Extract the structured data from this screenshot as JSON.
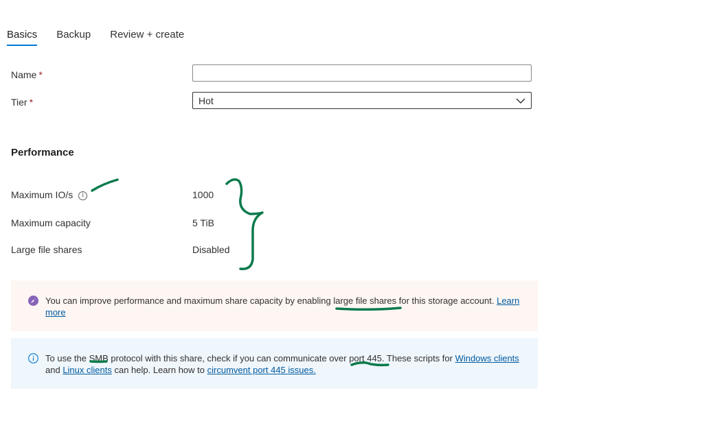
{
  "tabs": [
    {
      "label": "Basics",
      "active": true
    },
    {
      "label": "Backup",
      "active": false
    },
    {
      "label": "Review + create",
      "active": false
    }
  ],
  "form": {
    "name_label": "Name",
    "name_value": "",
    "tier_label": "Tier",
    "tier_value": "Hot",
    "required_marker": "*"
  },
  "performance": {
    "title": "Performance",
    "rows": [
      {
        "label": "Maximum IO/s",
        "value": "1000",
        "has_info": true
      },
      {
        "label": "Maximum capacity",
        "value": "5 TiB"
      },
      {
        "label": "Large file shares",
        "value": "Disabled"
      }
    ]
  },
  "banners": {
    "warn": {
      "icon": "rocket-icon",
      "color": "#8764b8",
      "text_before": "You can improve performance and maximum share capacity by enabling large file shares for this storage account. ",
      "link": "Learn more"
    },
    "info": {
      "icon": "info-icon",
      "color": "#0078d4",
      "text_1": "To use the SMB protocol with this share, check if you can communicate over port 445. These scripts for ",
      "link_windows": "Windows clients",
      "text_2": " and ",
      "link_linux": "Linux clients",
      "text_3": " can help. Learn how to ",
      "link_circumvent": "circumvent port 445 issues."
    }
  },
  "annotation_color": "#0b7a4b"
}
